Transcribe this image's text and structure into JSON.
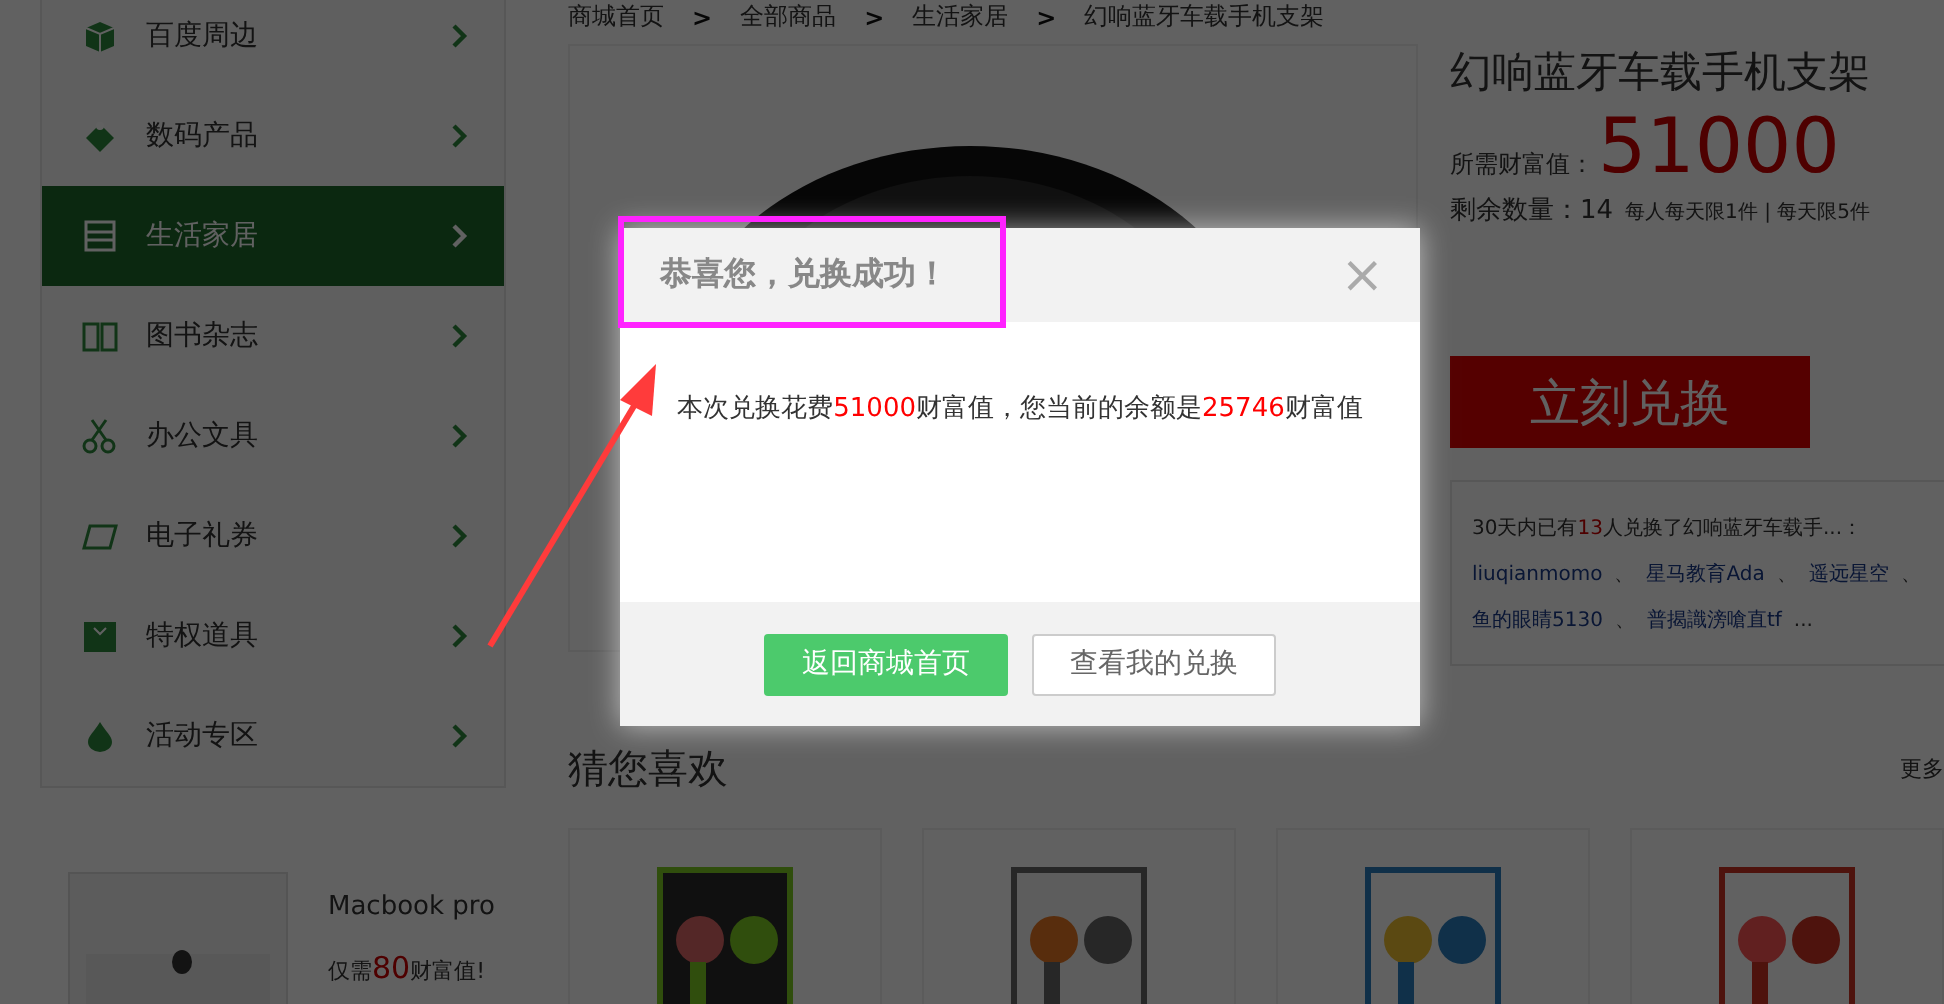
{
  "sidebar": {
    "items": [
      {
        "label": "百度周边",
        "selected": false
      },
      {
        "label": "数码产品",
        "selected": false
      },
      {
        "label": "生活家居",
        "selected": true
      },
      {
        "label": "图书杂志",
        "selected": false
      },
      {
        "label": "办公文具",
        "selected": false
      },
      {
        "label": "电子礼券",
        "selected": false
      },
      {
        "label": "特权道具",
        "selected": false
      },
      {
        "label": "活动专区",
        "selected": false
      }
    ]
  },
  "promo": {
    "title": "Macbook pro",
    "prefix": "仅需",
    "amount": "80",
    "suffix": "财富值!"
  },
  "breadcrumb": {
    "items": [
      "商城首页",
      "全部商品",
      "生活家居",
      "幻响蓝牙车载手机支架"
    ],
    "separator": ">"
  },
  "product": {
    "title": "幻响蓝牙车载手机支架",
    "price_label": "所需财富值：",
    "price": "51000",
    "stock": "剩余数量：14",
    "limit": "每人每天限1件 | 每天限5件",
    "button": "立刻兑换",
    "recent": {
      "prefix": "30天内已有",
      "count": "13",
      "suffix": "人兑换了幻响蓝牙车载手...：",
      "users": [
        "liuqianmomo",
        "星马教育Ada",
        "遥远星空",
        "鱼的眼睛5130",
        "普揭識滂嗆直tf"
      ],
      "separator": "、",
      "more": "..."
    }
  },
  "recommend": {
    "title": "猜您喜欢",
    "more": "更多"
  },
  "dialog": {
    "title": "恭喜您，兑换成功！",
    "close": "×",
    "message": [
      {
        "text": "本次兑换花费",
        "highlight": false
      },
      {
        "text": "51000",
        "highlight": true
      },
      {
        "text": "财富值，您当前的余额是",
        "highlight": false
      },
      {
        "text": "25746",
        "highlight": true
      },
      {
        "text": "财富值",
        "highlight": false
      }
    ],
    "buttons": [
      {
        "label": "返回商城首页",
        "kind": "primary"
      },
      {
        "label": "查看我的兑换",
        "kind": "secondary"
      }
    ]
  }
}
